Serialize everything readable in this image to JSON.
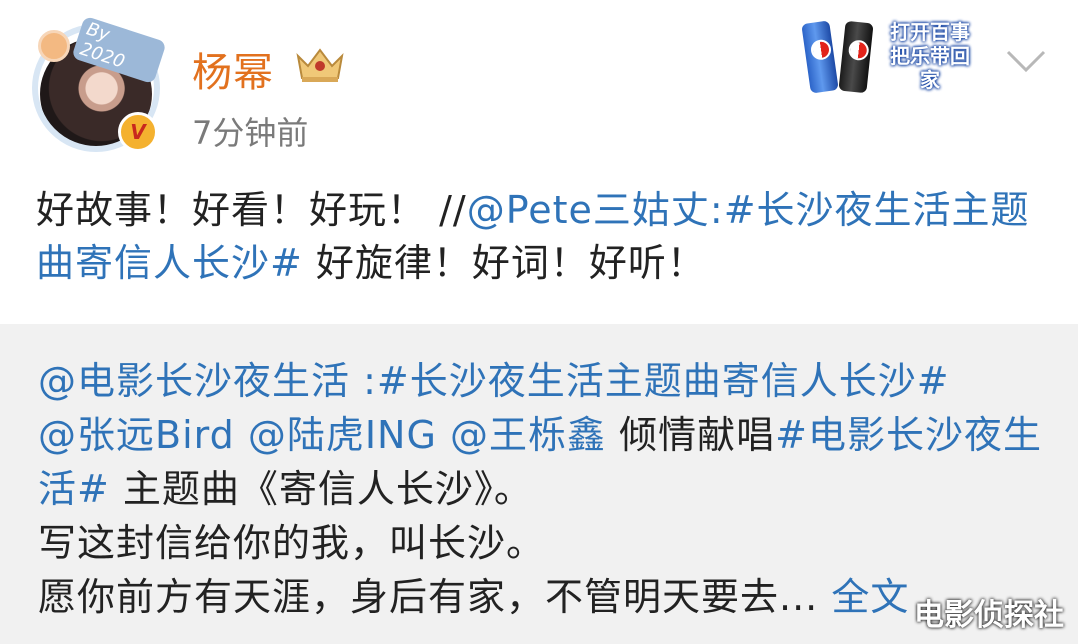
{
  "header": {
    "user_name": "杨幂",
    "post_time": "7分钟前",
    "avatar_frame_badge": "By 2020",
    "verified_badge": "V",
    "ad_text": "打开百事 把乐带回家",
    "icons": [
      "crown-icon",
      "chevron-down-icon",
      "verified-icon"
    ]
  },
  "post": {
    "text_prefix": "好故事！好看！好玩！ //",
    "mention_pete": "@Pete三姑丈",
    "colon": ":",
    "topic_line": "#长沙夜生活主题曲寄信人长沙#",
    "text_suffix": " 好旋律！好词！好听！"
  },
  "repost": {
    "mention_film": "@电影长沙夜生活",
    "colon": " :",
    "topic_song": "#长沙夜生活主题曲寄信人长沙#",
    "mention_zhang": "@张远Bird",
    "mention_lu": "@陆虎ING",
    "mention_wang": "@王栎鑫",
    "sing_text": " 倾情献唱",
    "topic_film": "#电影长沙夜生活#",
    "theme_text": " 主题曲《寄信人长沙》。",
    "line_letter": "写这封信给你的我，叫长沙。",
    "line_wish": "愿你前方有天涯，身后有家，不管明天要去...",
    "expand_label": "全文"
  },
  "watermark": "电影侦探社",
  "colors": {
    "name": "#e2711e",
    "link": "#2f73b8",
    "repost_bg": "#f1f1f1",
    "text": "#222222",
    "time": "#7a7a7a"
  }
}
